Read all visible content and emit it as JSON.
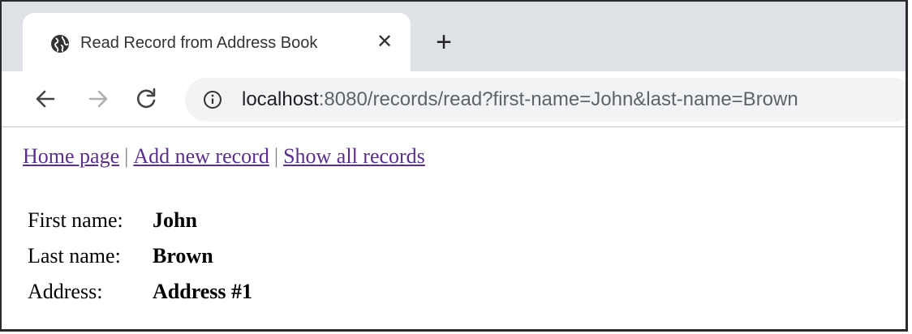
{
  "browser": {
    "tab": {
      "title": "Read Record from Address Book",
      "icon": "globe-icon",
      "close_glyph": "✕"
    },
    "new_tab_glyph": "+",
    "toolbar": {
      "back_icon": "arrow-left-icon",
      "forward_icon": "arrow-right-icon",
      "reload_icon": "reload-icon"
    },
    "address_bar": {
      "icon": "info-icon",
      "host": "localhost",
      "rest": ":8080/records/read?first-name=John&last-name=Brown"
    }
  },
  "page": {
    "nav_links": {
      "home": "Home page",
      "add": "Add new record",
      "show_all": "Show all records",
      "separator": "|"
    },
    "record": [
      {
        "label": "First name:",
        "value": "John"
      },
      {
        "label": "Last name:",
        "value": "Brown"
      },
      {
        "label": "Address:",
        "value": "Address #1"
      }
    ]
  },
  "colors": {
    "tabstrip_bg": "#dee1e6",
    "omnibox_bg": "#f1f3f4",
    "visited_link": "#5a2f8a"
  }
}
